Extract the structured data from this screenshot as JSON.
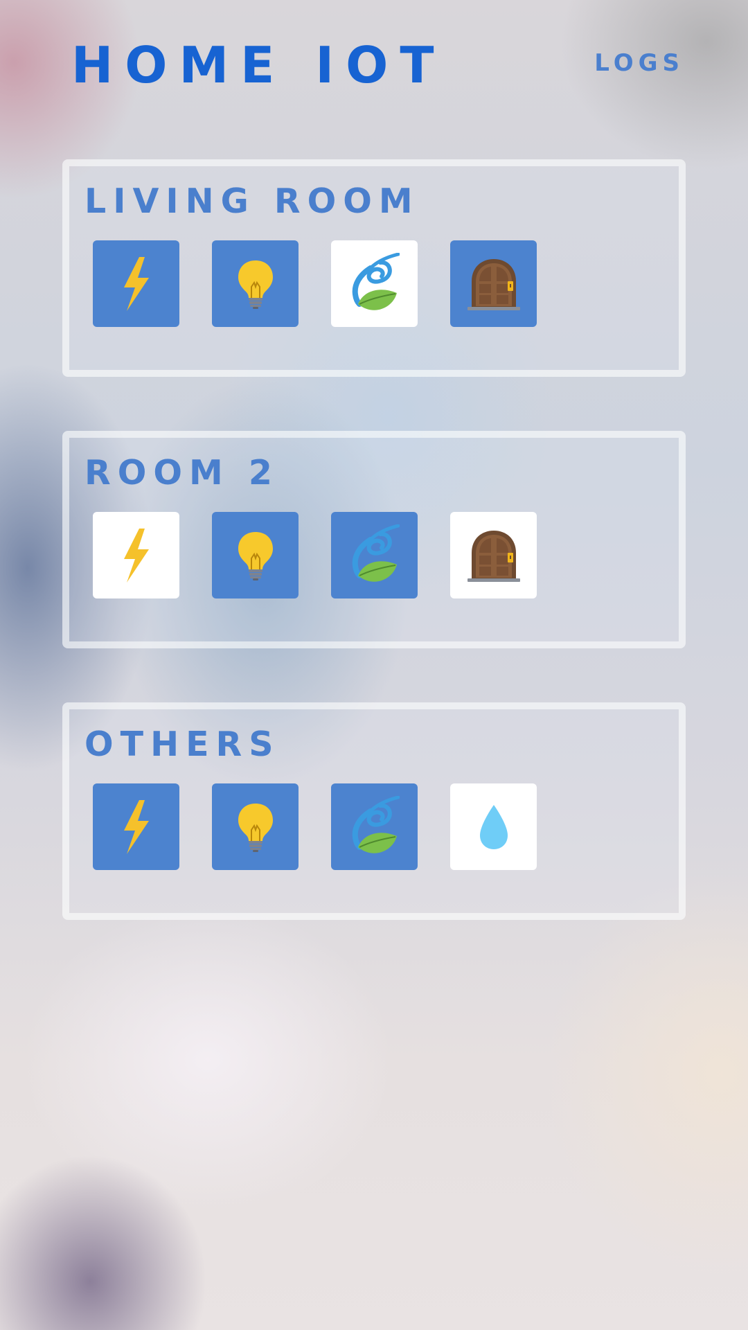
{
  "app": {
    "title": "HOME IOT",
    "logs_label": "LOGS"
  },
  "colors": {
    "accent": "#1763d2",
    "room_title": "#4a7fcd",
    "tile_on": "#4c83cf",
    "tile_off": "#ffffff"
  },
  "rooms": [
    {
      "title": "LIVING ROOM",
      "devices": [
        {
          "icon": "lightning-icon",
          "state": "on"
        },
        {
          "icon": "bulb-icon",
          "state": "on"
        },
        {
          "icon": "eco-leaf-icon",
          "state": "off"
        },
        {
          "icon": "door-icon",
          "state": "on"
        }
      ]
    },
    {
      "title": "ROOM 2",
      "devices": [
        {
          "icon": "lightning-icon",
          "state": "off"
        },
        {
          "icon": "bulb-icon",
          "state": "on"
        },
        {
          "icon": "eco-leaf-icon",
          "state": "on"
        },
        {
          "icon": "door-icon",
          "state": "off"
        }
      ]
    },
    {
      "title": "OTHERS",
      "devices": [
        {
          "icon": "lightning-icon",
          "state": "on"
        },
        {
          "icon": "bulb-icon",
          "state": "on"
        },
        {
          "icon": "eco-leaf-icon",
          "state": "on"
        },
        {
          "icon": "water-drop-icon",
          "state": "off"
        }
      ]
    }
  ]
}
